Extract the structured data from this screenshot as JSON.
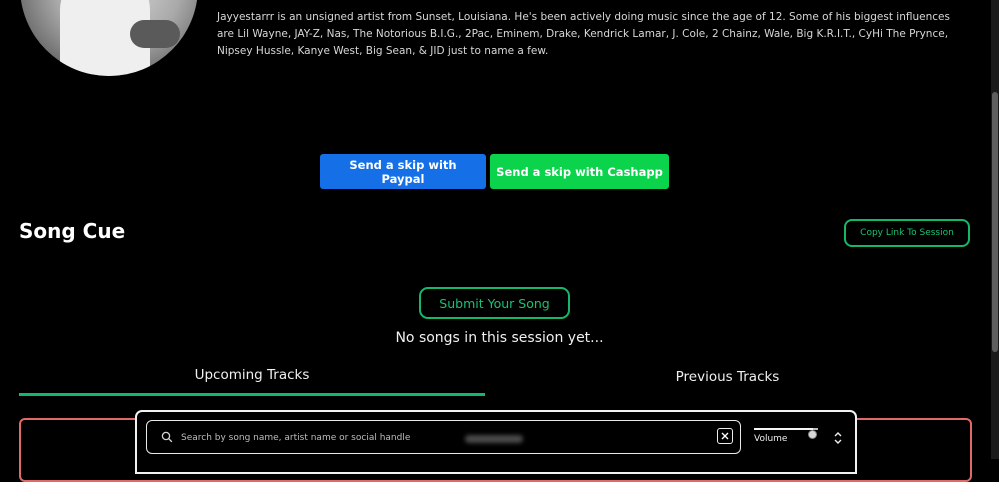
{
  "artist": {
    "bio": "Jayyestarrr is an unsigned artist from Sunset, Louisiana. He's been actively doing music since the age of 12. Some of his biggest influences are Lil Wayne, JAY-Z, Nas, The Notorious B.I.G., 2Pac, Eminem, Drake, Kendrick Lamar, J. Cole, 2 Chainz, Wale, Big K.R.I.T., CyHi The Prynce, Nipsey Hussle, Kanye West, Big Sean, & JID just to name a few."
  },
  "actions": {
    "paypal_label": "Send a skip with Paypal",
    "cashapp_label": "Send a skip with Cashapp"
  },
  "session": {
    "title": "Song Cue",
    "copy_link_label": "Copy Link To Session",
    "submit_label": "Submit Your Song",
    "empty_message": "No songs in this session yet..."
  },
  "tabs": {
    "upcoming": "Upcoming Tracks",
    "previous": "Previous Tracks"
  },
  "player": {
    "search_placeholder": "Search by song name, artist name or social handle",
    "volume_label": "Volume",
    "volume_level": 0.92
  },
  "colors": {
    "paypal": "#1570e8",
    "cashapp": "#0bd34b",
    "accent_green": "#15b86b",
    "tracks_border": "#e06a6a"
  },
  "icons": {
    "search": "search-icon",
    "clear": "close-icon",
    "toggle": "chevron-up-down-icon"
  }
}
